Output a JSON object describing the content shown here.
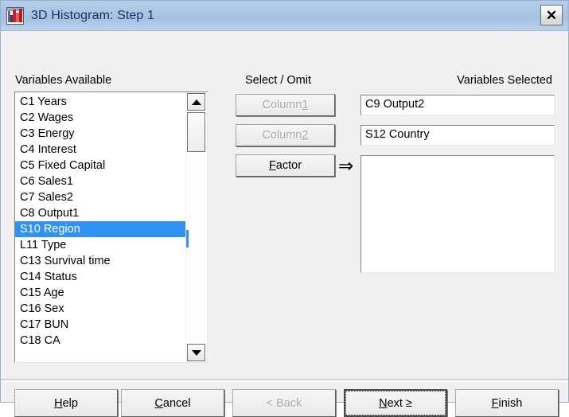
{
  "window": {
    "title": "3D Histogram: Step 1",
    "icon": "histogram-icon",
    "close_label": "✕"
  },
  "labels": {
    "variables_available": "Variables Available",
    "select_omit": "Select / Omit",
    "variables_selected": "Variables Selected"
  },
  "variables_available": {
    "items": [
      {
        "label": "C1 Years",
        "selected": false
      },
      {
        "label": "C2 Wages",
        "selected": false
      },
      {
        "label": "C3 Energy",
        "selected": false
      },
      {
        "label": "C4 Interest",
        "selected": false
      },
      {
        "label": "C5 Fixed Capital",
        "selected": false
      },
      {
        "label": "C6 Sales1",
        "selected": false
      },
      {
        "label": "C7 Sales2",
        "selected": false
      },
      {
        "label": "C8 Output1",
        "selected": false
      },
      {
        "label": "S10 Region",
        "selected": true
      },
      {
        "label": "L11 Type",
        "selected": false
      },
      {
        "label": "C13 Survival time",
        "selected": false
      },
      {
        "label": "C14 Status",
        "selected": false
      },
      {
        "label": "C15 Age",
        "selected": false
      },
      {
        "label": "C16 Sex",
        "selected": false
      },
      {
        "label": "C17 BUN",
        "selected": false
      },
      {
        "label": "C18 CA",
        "selected": false
      }
    ],
    "scrollbar": {
      "up_icon": "scroll-up-arrow-icon",
      "down_icon": "scroll-down-arrow-icon"
    }
  },
  "select_omit_buttons": [
    {
      "name": "column-1",
      "label": "Column ",
      "accel": "1",
      "disabled": true
    },
    {
      "name": "column-2",
      "label": "Column ",
      "accel": "2",
      "disabled": true
    },
    {
      "name": "factor",
      "label": "actor",
      "accel": "F",
      "disabled": false
    }
  ],
  "transfer_arrow": {
    "icon": "right-arrow-icon",
    "glyph": "⇒"
  },
  "variables_selected": {
    "column1_value": "C9 Output2",
    "column2_value": "S12 Country",
    "factor_value": "",
    "placeholder": ""
  },
  "footer_buttons": [
    {
      "name": "help",
      "pre": "H",
      "label": "elp",
      "disabled": false,
      "default": false
    },
    {
      "name": "cancel",
      "pre": "C",
      "label": "ancel",
      "disabled": false,
      "default": false
    },
    {
      "name": "back",
      "pre": "",
      "label": "< Back",
      "disabled": true,
      "default": false
    },
    {
      "name": "next",
      "pre": "N",
      "label": "ext ≥",
      "disabled": false,
      "default": true
    },
    {
      "name": "finish",
      "pre": "F",
      "label": "inish",
      "disabled": false,
      "default": false
    }
  ],
  "colors": {
    "titlebar": "#a9c6e6",
    "title_text": "#13325b",
    "dialog_bg": "#f0f0f0",
    "selection": "#2f93f5",
    "disabled_text": "#a8a8a8"
  }
}
